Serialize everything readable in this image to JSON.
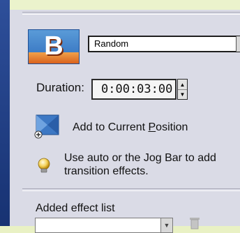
{
  "transition_panel": {
    "effect_select": {
      "selected": "Random",
      "options": [
        "Random"
      ]
    },
    "duration": {
      "label": "Duration:",
      "value": "0:00:03:00"
    },
    "add_to_position": {
      "pre": "Add to Current ",
      "accel": "P",
      "post": "osition"
    },
    "hint": "Use auto or the Jog Bar to add transition effects.",
    "added_effect_list": {
      "label": "Added effect list"
    }
  },
  "icons": {
    "logo": "transition-b-logo-icon",
    "dropdown": "chevron-down-icon",
    "spin_up": "spin-up-icon",
    "spin_down": "spin-down-icon",
    "add": "add-transition-icon",
    "bulb": "lightbulb-icon",
    "trash": "trash-icon"
  },
  "colors": {
    "background": "#e9f1c4",
    "panel": "#dadbe6",
    "accent_blue": "#2f6dbd",
    "accent_orange": "#d9621d"
  }
}
